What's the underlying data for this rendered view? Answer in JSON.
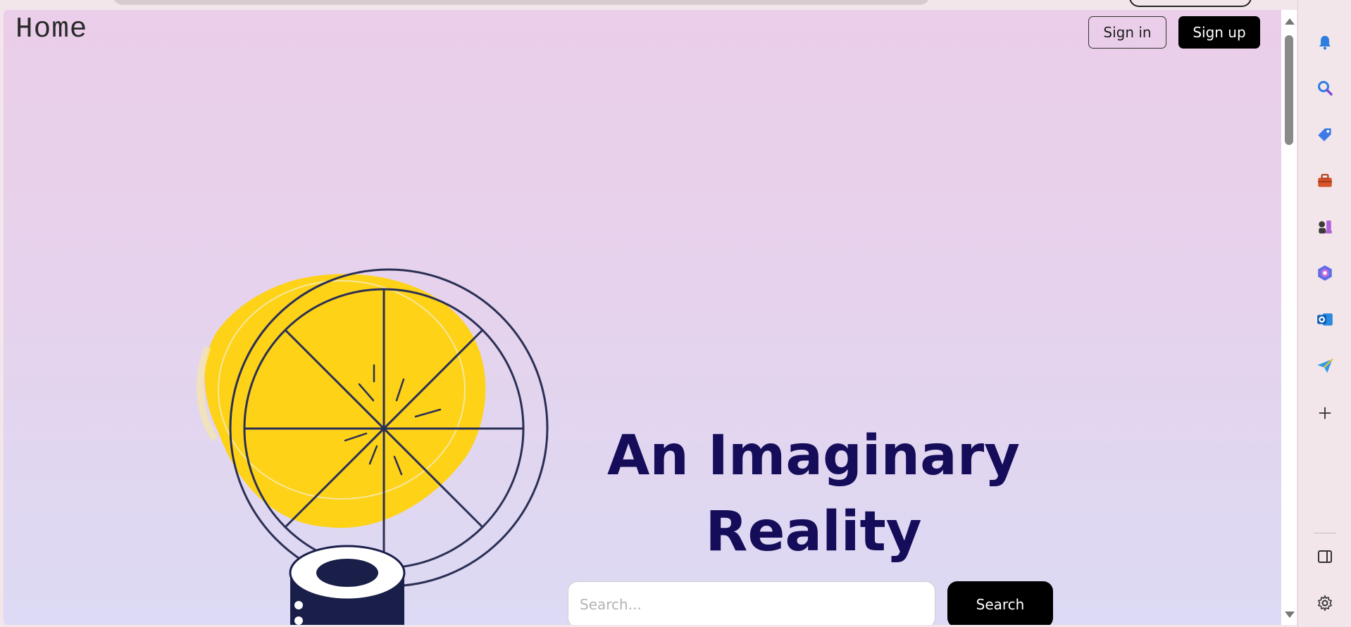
{
  "nav": {
    "home_label": "Home",
    "sign_in_label": "Sign in",
    "sign_up_label": "Sign up"
  },
  "hero": {
    "title_line1": "An Imaginary",
    "title_line2": "Reality"
  },
  "search": {
    "placeholder": "Search...",
    "value": "",
    "button_label": "Search"
  },
  "sidebar": {
    "items": [
      {
        "icon": "bell-icon"
      },
      {
        "icon": "search-icon"
      },
      {
        "icon": "tag-icon"
      },
      {
        "icon": "toolbox-icon"
      },
      {
        "icon": "chess-icon"
      },
      {
        "icon": "copilot-icon"
      },
      {
        "icon": "outlook-icon"
      },
      {
        "icon": "send-icon"
      },
      {
        "icon": "add-icon"
      }
    ],
    "bottom": [
      {
        "icon": "sidebar-toggle-icon"
      },
      {
        "icon": "settings-icon"
      }
    ]
  },
  "colors": {
    "hero_title": "#150c5a",
    "gradient_top": "#ebcee9",
    "gradient_bottom": "#dcdaf4",
    "lemon": "#fdd217",
    "ink": "#2a2f55"
  }
}
